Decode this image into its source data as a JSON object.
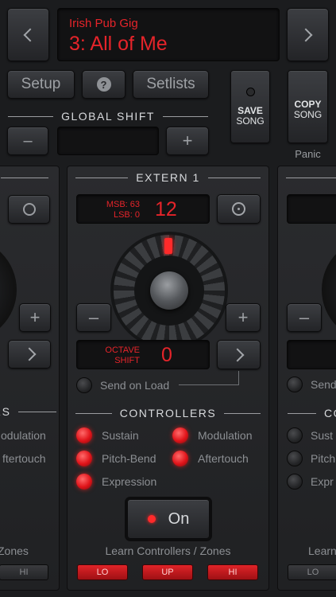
{
  "header": {
    "gig_name": "Irish Pub Gig",
    "song_title": "3: All of Me"
  },
  "toolbar": {
    "setup_label": "Setup",
    "help_label": "?",
    "setlists_label": "Setlists"
  },
  "save_song": {
    "line1": "SAVE",
    "line2": "SONG"
  },
  "copy_song": {
    "line1": "COPY",
    "line2": "SONG"
  },
  "panic_label": "Panic",
  "global_shift": {
    "title": "GLOBAL SHIFT",
    "minus": "–",
    "plus": "+",
    "value": ""
  },
  "center": {
    "title": "EXTERN 1",
    "msb": "MSB: 63",
    "lsb": "LSB: 0",
    "program": "12",
    "minus": "–",
    "plus": "+",
    "octave_label_1": "OCTAVE",
    "octave_label_2": "SHIFT",
    "octave_value": "0",
    "send_on_load": "Send on Load",
    "controllers_title": "CONTROLLERS",
    "controllers": [
      "Sustain",
      "Modulation",
      "Pitch-Bend",
      "Aftertouch",
      "Expression"
    ],
    "on_label": "On",
    "learn_label": "Learn Controllers / Zones",
    "zones": [
      "LO",
      "UP",
      "HI"
    ]
  },
  "left": {
    "controllers_partial": "RS",
    "items": [
      "odulation",
      "ftertouch"
    ],
    "learn": "Zones",
    "zone_hi": "HI"
  },
  "right": {
    "send_partial": "Send",
    "controllers_partial": "CO",
    "items": [
      "Sust",
      "Pitch",
      "Expr"
    ],
    "learn": "Learn",
    "zone_lo": "LO"
  }
}
